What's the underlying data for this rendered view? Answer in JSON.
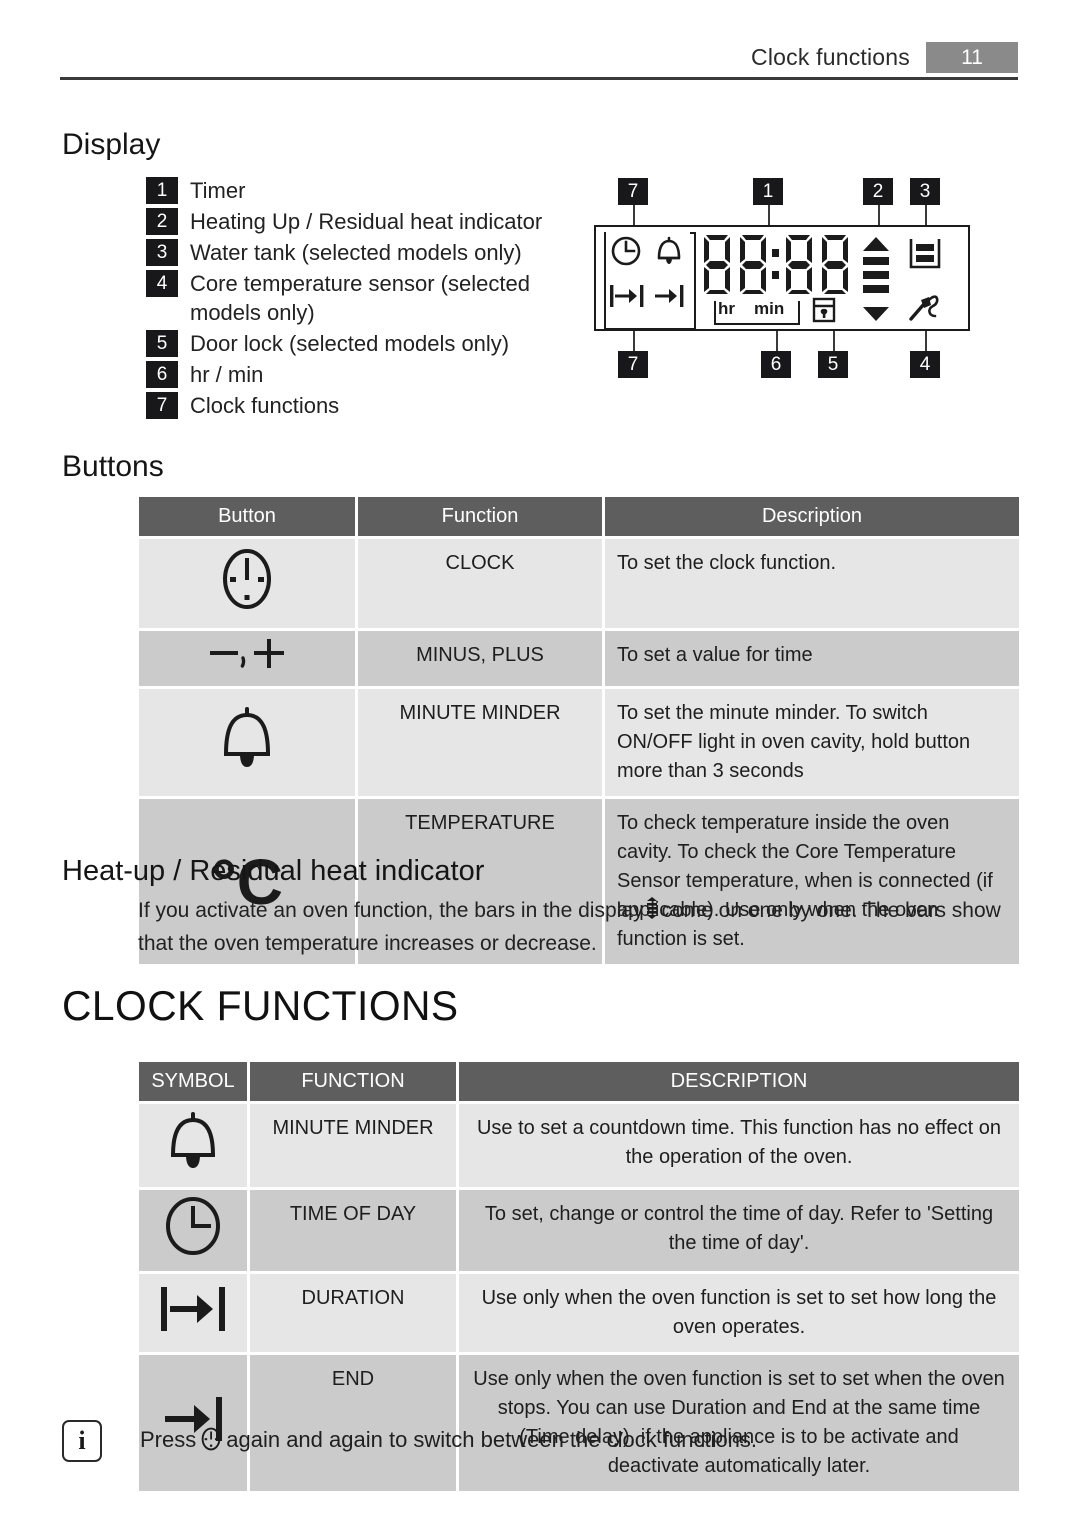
{
  "header": {
    "title": "Clock functions",
    "page_number": "11"
  },
  "display_section": {
    "heading": "Display",
    "legend": [
      {
        "num": "1",
        "label": "Timer"
      },
      {
        "num": "2",
        "label": "Heating Up / Residual heat indicator"
      },
      {
        "num": "3",
        "label": "Water tank (selected models only)"
      },
      {
        "num": "4",
        "label": "Core temperature sensor (selected models only)"
      },
      {
        "num": "5",
        "label": "Door lock (selected models only)"
      },
      {
        "num": "6",
        "label": "hr / min"
      },
      {
        "num": "7",
        "label": "Clock functions"
      }
    ],
    "figure": {
      "callouts_top": [
        "7",
        "1",
        "2",
        "3"
      ],
      "callouts_bottom": [
        "7",
        "6",
        "5",
        "4"
      ],
      "digits": "88:88",
      "hr_label": "hr",
      "min_label": "min",
      "icons": [
        "clock-icon",
        "bell-icon",
        "duration-icon",
        "end-icon",
        "heat-bars-icon",
        "water-tank-icon",
        "core-sensor-icon",
        "door-lock-icon"
      ]
    }
  },
  "buttons_section": {
    "heading": "Buttons",
    "columns": [
      "Button",
      "Function",
      "Description"
    ],
    "rows": [
      {
        "symbol": "clock-button-icon",
        "function": "CLOCK",
        "description": "To set the clock function."
      },
      {
        "symbol": "minus-plus-icon",
        "function": "MINUS, PLUS",
        "description": "To set a value for time"
      },
      {
        "symbol": "bell-icon",
        "function": "MINUTE MINDER",
        "description": "To set the minute minder. To switch ON/OFF light in oven cavity, hold button more than 3 seconds"
      },
      {
        "symbol": "degrees-celsius-icon",
        "function": "TEMPERATURE",
        "description": "To check temperature inside the oven cavity. To check the Core Temperature Sensor temperature, when is connected (if applicable). Use only when the oven function is set."
      }
    ]
  },
  "heatup_section": {
    "heading": "Heat-up / Residual heat indicator",
    "text_before": "If you activate an oven function, the bars in the display",
    "text_after": "come on one by one. The bars show that the oven temperature increases or decrease."
  },
  "clock_functions_section": {
    "heading": "CLOCK FUNCTIONS",
    "columns": [
      "SYMBOL",
      "FUNCTION",
      "DESCRIPTION"
    ],
    "rows": [
      {
        "symbol": "bell-icon",
        "function": "MINUTE MINDER",
        "description": "Use to set a countdown time. This function has no effect on the operation of the oven."
      },
      {
        "symbol": "clock-icon",
        "function": "TIME OF DAY",
        "description": "To set, change or control the time of day. Refer to 'Setting the time of day'."
      },
      {
        "symbol": "duration-icon",
        "function": "DURATION",
        "description": "Use only when the oven function is set to set how long the oven operates."
      },
      {
        "symbol": "end-icon",
        "function": "END",
        "description": "Use only when the oven function is set to set when the oven stops. You can use Duration and End at the same time (Time delay), if the appliance is to be activate and deactivate automatically later."
      }
    ]
  },
  "note": {
    "icon": "info-icon",
    "text_before": "Press",
    "text_after": "again and again to switch between the clock functions."
  },
  "colors": {
    "table_header": "#5e5e5e",
    "row_light": "#e6e6e6",
    "row_mid": "#cbcbcb",
    "callout_box": "#18171a",
    "page_number_box": "#8a8a8a"
  }
}
